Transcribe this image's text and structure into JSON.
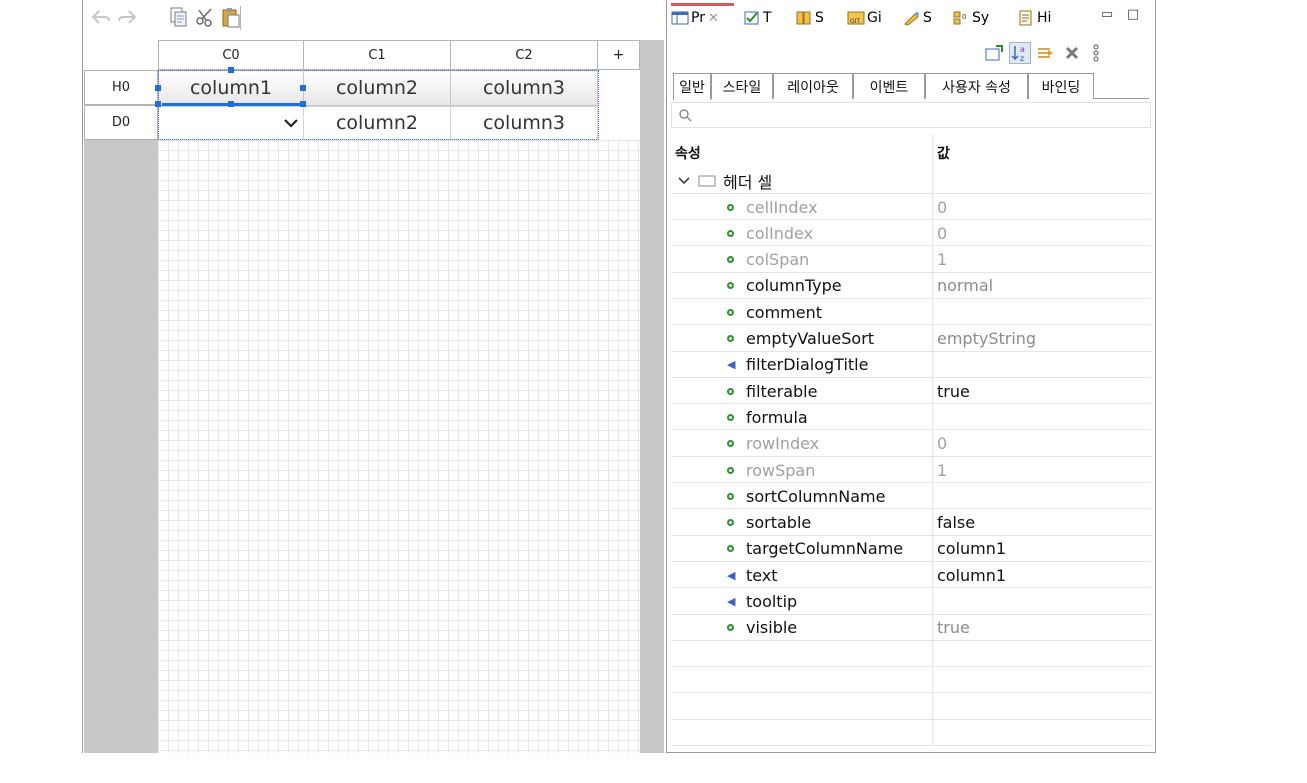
{
  "designer": {
    "columns": [
      "C0",
      "C1",
      "C2"
    ],
    "add_column_label": "+",
    "row_headers": [
      "H0",
      "D0"
    ],
    "header_cells": [
      "column1",
      "column2",
      "column3"
    ],
    "data_cells": [
      "",
      "column2",
      "column3"
    ],
    "selected_cell": "column1",
    "toolbar_icons": [
      "undo-icon",
      "redo-icon",
      "copy-icon",
      "cut-icon",
      "paste-icon"
    ]
  },
  "panel": {
    "view_tabs": [
      {
        "label": "Pr",
        "icon": "properties-icon",
        "active": true
      },
      {
        "label": "T",
        "icon": "task-icon"
      },
      {
        "label": "S",
        "icon": "servers-icon"
      },
      {
        "label": "Gi",
        "icon": "git-icon"
      },
      {
        "label": "S",
        "icon": "snippets-icon"
      },
      {
        "label": "Sy",
        "icon": "sync-icon"
      },
      {
        "label": "Hi",
        "icon": "history-icon"
      }
    ],
    "sub_tabs": [
      "일반",
      "스타일",
      "레이아웃",
      "이벤트",
      "사용자 속성",
      "바인딩"
    ],
    "active_sub_tab": "일반",
    "col_property": "속성",
    "col_value": "값",
    "group_name": "헤더 셀",
    "properties": [
      {
        "name": "cellIndex",
        "value": "0",
        "kind": "dot",
        "muted": true
      },
      {
        "name": "colIndex",
        "value": "0",
        "kind": "dot",
        "muted": true
      },
      {
        "name": "colSpan",
        "value": "1",
        "kind": "dot",
        "muted": true
      },
      {
        "name": "columnType",
        "value": "normal",
        "kind": "dot",
        "muted": false,
        "value_muted": true
      },
      {
        "name": "comment",
        "value": "",
        "kind": "dot",
        "muted": false
      },
      {
        "name": "emptyValueSort",
        "value": "emptyString",
        "kind": "dot",
        "muted": false,
        "value_muted": true
      },
      {
        "name": "filterDialogTitle",
        "value": "",
        "kind": "speaker",
        "muted": false
      },
      {
        "name": "filterable",
        "value": "true",
        "kind": "dot",
        "muted": false
      },
      {
        "name": "formula",
        "value": "",
        "kind": "dot",
        "muted": false
      },
      {
        "name": "rowIndex",
        "value": "0",
        "kind": "dot",
        "muted": true
      },
      {
        "name": "rowSpan",
        "value": "1",
        "kind": "dot",
        "muted": true
      },
      {
        "name": "sortColumnName",
        "value": "",
        "kind": "dot",
        "muted": false
      },
      {
        "name": "sortable",
        "value": "false",
        "kind": "dot",
        "muted": false
      },
      {
        "name": "targetColumnName",
        "value": "column1",
        "kind": "dot",
        "muted": false
      },
      {
        "name": "text",
        "value": "column1",
        "kind": "speaker",
        "muted": false
      },
      {
        "name": "tooltip",
        "value": "",
        "kind": "speaker",
        "muted": false
      },
      {
        "name": "visible",
        "value": "true",
        "kind": "dot",
        "muted": false,
        "value_muted": true
      }
    ]
  }
}
